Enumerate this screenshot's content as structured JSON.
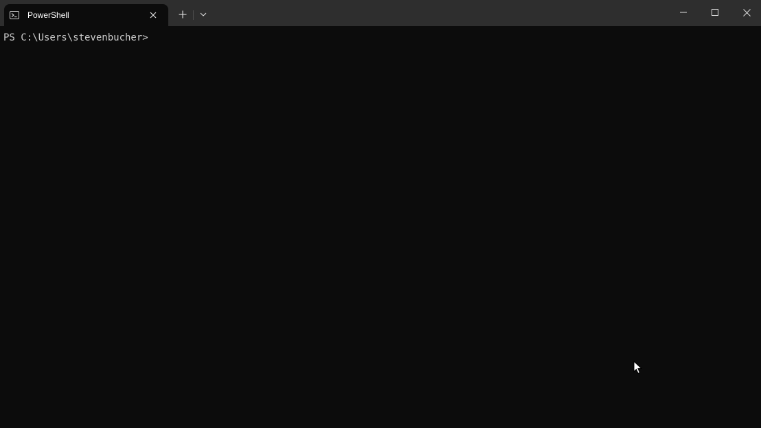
{
  "tab": {
    "title": "PowerShell",
    "icon": "powershell-icon"
  },
  "titlebar": {
    "new_tab_icon": "plus-icon",
    "dropdown_icon": "chevron-down-icon",
    "minimize_icon": "minimize-icon",
    "maximize_icon": "maximize-icon",
    "close_icon": "close-icon"
  },
  "terminal": {
    "prompt": "PS C:\\Users\\stevenbucher>"
  },
  "colors": {
    "titlebar_bg": "#2e2e2e",
    "terminal_bg": "#0c0c0c",
    "prompt_text": "#cccccc"
  }
}
